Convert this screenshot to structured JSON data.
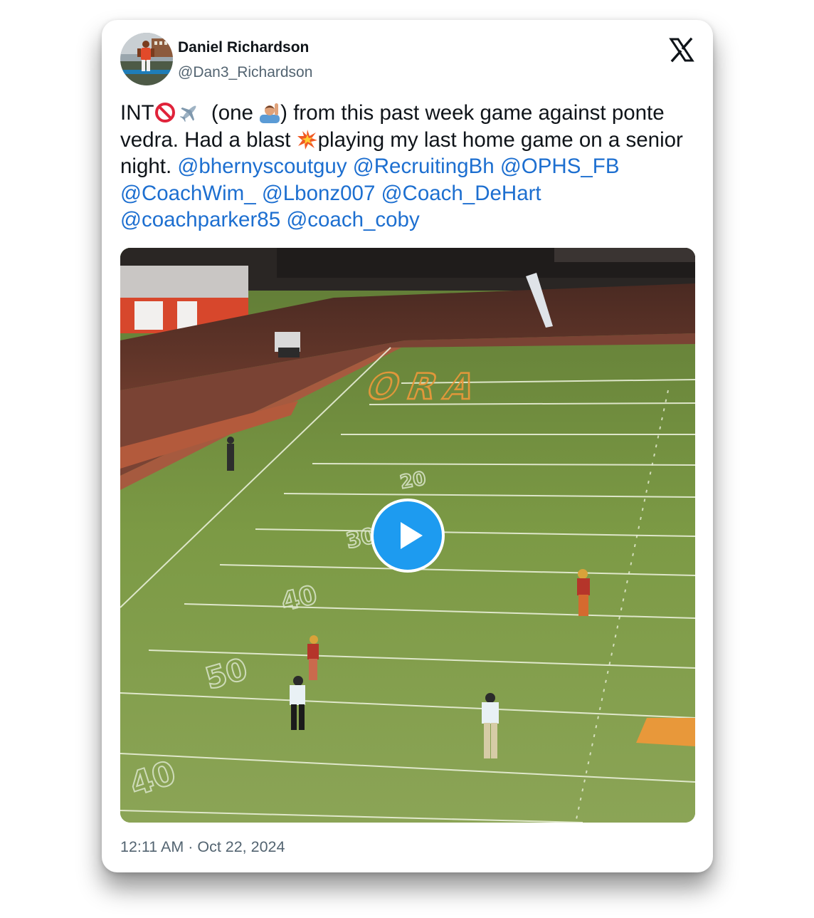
{
  "author": {
    "display_name": "Daniel Richardson",
    "handle": "@Dan3_Richardson",
    "avatar_icon": "profile-photo"
  },
  "brand": {
    "logo_icon": "x-logo-icon"
  },
  "tweet": {
    "text_parts": [
      {
        "type": "text",
        "value": "INT"
      },
      {
        "type": "emoji",
        "value": "no-entry-emoji"
      },
      {
        "type": "emoji",
        "value": "airplane-emoji"
      },
      {
        "type": "text",
        "value": "  (one "
      },
      {
        "type": "emoji",
        "value": "person-raising-hand-emoji"
      },
      {
        "type": "text",
        "value": ") from this past week game against ponte vedra. Had a blast "
      },
      {
        "type": "emoji",
        "value": "collision-emoji"
      },
      {
        "type": "text",
        "value": "playing my last home game on a senior night. "
      }
    ],
    "mentions": [
      "@bhernyscoutguy",
      "@RecruitingBh",
      "@OPHS_FB",
      "@CoachWim_",
      "@Lbonz007",
      "@Coach_DeHart",
      "@coachparker85",
      "@coach_coby"
    ]
  },
  "media": {
    "type": "video",
    "play_icon": "play-icon",
    "field_lettering": "ORA",
    "yard_numbers": [
      "20",
      "30",
      "40",
      "50",
      "40"
    ]
  },
  "timestamp": "12:11 AM · Oct 22, 2024",
  "colors": {
    "mention": "#1d6fd0",
    "play_button": "#1d9bf0",
    "secondary_text": "#536471"
  }
}
